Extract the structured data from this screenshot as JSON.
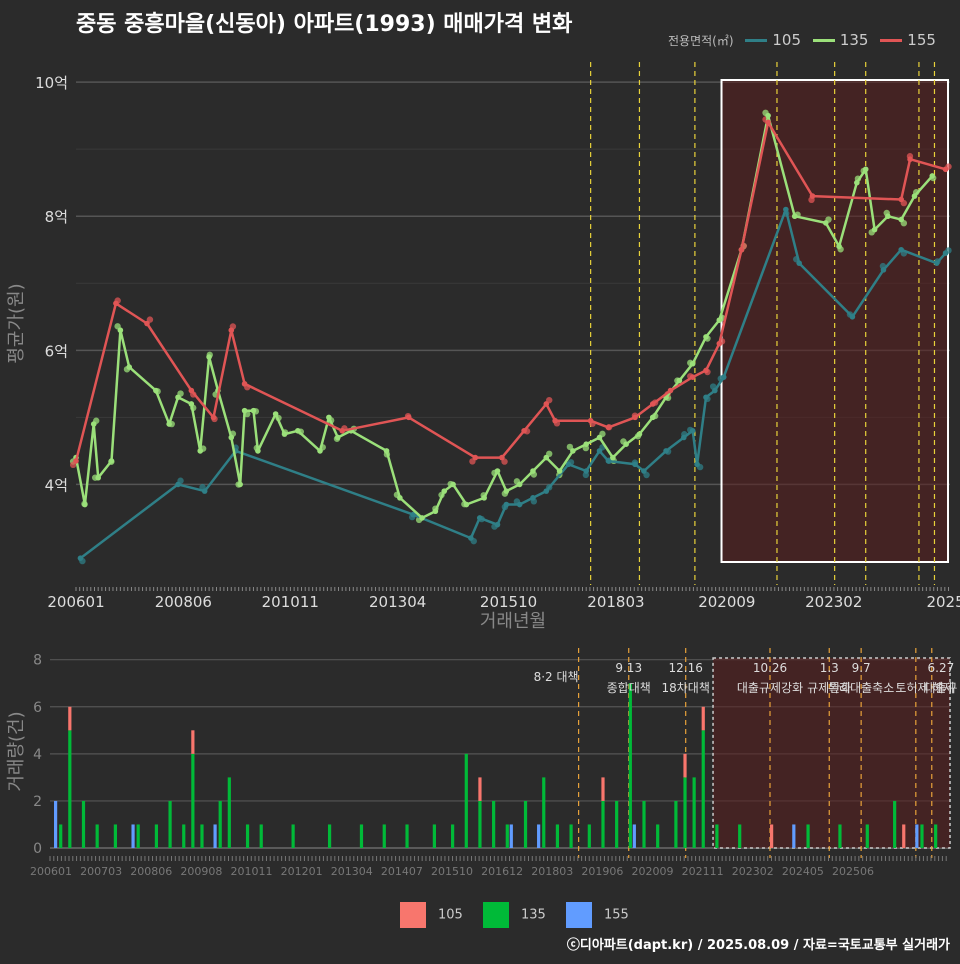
{
  "title": "중동 중흥마을(신동아) 아파트(1993) 매매가격 변화",
  "legend_title": "전용면적(㎡)",
  "colors": {
    "105": "#2f7f87",
    "135": "#9be07a",
    "155": "#e05555",
    "vol105": "#f8766d",
    "vol135": "#00ba38",
    "vol155": "#619cff",
    "event": "#e8d23a"
  },
  "caption": "ⓒ디아파트(dapt.kr) / 2025.08.09 / 자료=국토교통부 실거래가",
  "chart_data": [
    {
      "type": "line",
      "title": "중동 중흥마을(신동아) 아파트(1993) 매매가격 변화",
      "xlabel": "거래년월",
      "ylabel": "평균가(원)",
      "x_ticks": [
        "200601",
        "200806",
        "201011",
        "201304",
        "201510",
        "201803",
        "202009",
        "202302",
        "2025"
      ],
      "y_ticks": [
        "4억",
        "6억",
        "8억",
        "10억"
      ],
      "ylim": [
        2.5,
        10.3
      ],
      "xlim": [
        2006.0,
        2025.7
      ],
      "series": [
        {
          "name": "105",
          "points": [
            [
              2006.1,
              2.9
            ],
            [
              2008.3,
              4.0
            ],
            [
              2008.9,
              3.9
            ],
            [
              2009.6,
              4.5
            ],
            [
              2013.6,
              3.55
            ],
            [
              2014.9,
              3.2
            ],
            [
              2015.1,
              3.5
            ],
            [
              2015.5,
              3.4
            ],
            [
              2015.7,
              3.7
            ],
            [
              2016.0,
              3.7
            ],
            [
              2016.3,
              3.8
            ],
            [
              2016.6,
              3.9
            ],
            [
              2017.1,
              4.3
            ],
            [
              2017.5,
              4.2
            ],
            [
              2017.8,
              4.5
            ],
            [
              2018.0,
              4.35
            ],
            [
              2018.6,
              4.3
            ],
            [
              2018.8,
              4.2
            ],
            [
              2019.3,
              4.5
            ],
            [
              2019.7,
              4.7
            ],
            [
              2019.9,
              4.8
            ],
            [
              2020.0,
              4.3
            ],
            [
              2020.2,
              5.3
            ],
            [
              2020.4,
              5.4
            ],
            [
              2020.6,
              5.6
            ],
            [
              2022.0,
              8.1
            ],
            [
              2022.3,
              7.3
            ],
            [
              2023.5,
              6.5
            ],
            [
              2024.2,
              7.2
            ],
            [
              2024.6,
              7.5
            ],
            [
              2025.4,
              7.3
            ],
            [
              2025.6,
              7.45
            ]
          ]
        },
        {
          "name": "135",
          "points": [
            [
              2006.0,
              4.4
            ],
            [
              2006.2,
              3.7
            ],
            [
              2006.4,
              4.9
            ],
            [
              2006.5,
              4.1
            ],
            [
              2006.8,
              4.35
            ],
            [
              2007.0,
              6.3
            ],
            [
              2007.2,
              5.75
            ],
            [
              2007.8,
              5.4
            ],
            [
              2008.1,
              4.9
            ],
            [
              2008.3,
              5.3
            ],
            [
              2008.6,
              5.2
            ],
            [
              2008.8,
              4.5
            ],
            [
              2009.0,
              5.9
            ],
            [
              2009.2,
              5.4
            ],
            [
              2009.5,
              4.7
            ],
            [
              2009.7,
              4.0
            ],
            [
              2009.8,
              5.1
            ],
            [
              2010.0,
              5.1
            ],
            [
              2010.1,
              4.5
            ],
            [
              2010.5,
              5.05
            ],
            [
              2010.7,
              4.75
            ],
            [
              2011.0,
              4.8
            ],
            [
              2011.5,
              4.5
            ],
            [
              2011.7,
              5.0
            ],
            [
              2011.9,
              4.7
            ],
            [
              2012.2,
              4.8
            ],
            [
              2013.0,
              4.5
            ],
            [
              2013.3,
              3.8
            ],
            [
              2013.8,
              3.5
            ],
            [
              2014.1,
              3.6
            ],
            [
              2014.3,
              3.9
            ],
            [
              2014.5,
              4.0
            ],
            [
              2014.8,
              3.7
            ],
            [
              2015.2,
              3.8
            ],
            [
              2015.5,
              4.2
            ],
            [
              2015.7,
              3.9
            ],
            [
              2016.0,
              4.0
            ],
            [
              2016.3,
              4.2
            ],
            [
              2016.6,
              4.4
            ],
            [
              2016.9,
              4.2
            ],
            [
              2017.2,
              4.5
            ],
            [
              2017.5,
              4.6
            ],
            [
              2017.8,
              4.7
            ],
            [
              2018.1,
              4.4
            ],
            [
              2018.4,
              4.6
            ],
            [
              2018.7,
              4.75
            ],
            [
              2019.0,
              5.0
            ],
            [
              2019.3,
              5.3
            ],
            [
              2019.6,
              5.55
            ],
            [
              2019.9,
              5.8
            ],
            [
              2020.2,
              6.2
            ],
            [
              2020.5,
              6.45
            ],
            [
              2021.0,
              7.5
            ],
            [
              2021.6,
              9.5
            ],
            [
              2022.2,
              8.0
            ],
            [
              2022.9,
              7.9
            ],
            [
              2023.2,
              7.55
            ],
            [
              2023.6,
              8.5
            ],
            [
              2023.8,
              8.7
            ],
            [
              2024.0,
              7.8
            ],
            [
              2024.3,
              8.0
            ],
            [
              2024.6,
              7.95
            ],
            [
              2024.9,
              8.3
            ],
            [
              2025.3,
              8.6
            ]
          ]
        },
        {
          "name": "155",
          "points": [
            [
              2006.0,
              4.35
            ],
            [
              2006.9,
              6.7
            ],
            [
              2007.6,
              6.4
            ],
            [
              2008.6,
              5.4
            ],
            [
              2009.1,
              5.0
            ],
            [
              2009.5,
              6.3
            ],
            [
              2009.8,
              5.5
            ],
            [
              2012.0,
              4.8
            ],
            [
              2013.5,
              5.0
            ],
            [
              2015.0,
              4.4
            ],
            [
              2015.6,
              4.4
            ],
            [
              2016.1,
              4.8
            ],
            [
              2016.6,
              5.2
            ],
            [
              2016.8,
              4.95
            ],
            [
              2017.6,
              4.95
            ],
            [
              2018.0,
              4.85
            ],
            [
              2018.6,
              5.0
            ],
            [
              2019.0,
              5.2
            ],
            [
              2019.4,
              5.4
            ],
            [
              2019.9,
              5.6
            ],
            [
              2020.2,
              5.7
            ],
            [
              2020.5,
              6.1
            ],
            [
              2021.0,
              7.5
            ],
            [
              2021.6,
              9.4
            ],
            [
              2022.6,
              8.3
            ],
            [
              2024.6,
              8.25
            ],
            [
              2024.8,
              8.85
            ],
            [
              2025.6,
              8.7
            ]
          ]
        }
      ],
      "highlight_range": [
        2020.55,
        2025.7
      ],
      "event_lines": [
        2017.6,
        2018.7,
        2019.95,
        2021.8,
        2023.1,
        2023.8,
        2025.0,
        2025.35
      ]
    },
    {
      "type": "bar",
      "xlabel": "",
      "ylabel": "거래량(건)",
      "x_ticks": [
        "200601",
        "200703",
        "200806",
        "200908",
        "201011",
        "201201",
        "201304",
        "201407",
        "201510",
        "201612",
        "201803",
        "201906",
        "202009",
        "202111",
        "202302",
        "202405",
        "202506"
      ],
      "y_ticks": [
        "0",
        "2",
        "4",
        "6",
        "8"
      ],
      "ylim": [
        0,
        8.2
      ],
      "stacked": true,
      "series_names": [
        "105",
        "135",
        "155"
      ],
      "bars_135": [
        [
          2006.2,
          1
        ],
        [
          2006.4,
          5
        ],
        [
          2006.7,
          2
        ],
        [
          2007.0,
          1
        ],
        [
          2007.4,
          1
        ],
        [
          2007.9,
          1
        ],
        [
          2008.3,
          1
        ],
        [
          2008.6,
          2
        ],
        [
          2008.9,
          1
        ],
        [
          2009.1,
          4
        ],
        [
          2009.3,
          1
        ],
        [
          2009.7,
          2
        ],
        [
          2009.9,
          3
        ],
        [
          2010.3,
          1
        ],
        [
          2010.6,
          1
        ],
        [
          2011.3,
          1
        ],
        [
          2012.1,
          1
        ],
        [
          2012.8,
          1
        ],
        [
          2013.3,
          1
        ],
        [
          2013.8,
          1
        ],
        [
          2014.4,
          1
        ],
        [
          2014.8,
          1
        ],
        [
          2015.1,
          4
        ],
        [
          2015.4,
          2
        ],
        [
          2015.7,
          2
        ],
        [
          2016.0,
          1
        ],
        [
          2016.4,
          2
        ],
        [
          2016.8,
          3
        ],
        [
          2017.1,
          1
        ],
        [
          2017.4,
          1
        ],
        [
          2017.8,
          1
        ],
        [
          2018.1,
          2
        ],
        [
          2018.4,
          2
        ],
        [
          2018.7,
          7
        ],
        [
          2019.0,
          2
        ],
        [
          2019.3,
          1
        ],
        [
          2019.7,
          2
        ],
        [
          2019.9,
          3
        ],
        [
          2020.1,
          3
        ],
        [
          2020.3,
          5
        ],
        [
          2020.6,
          1
        ],
        [
          2021.1,
          1
        ],
        [
          2022.6,
          1
        ],
        [
          2023.3,
          1
        ],
        [
          2023.9,
          1
        ],
        [
          2024.5,
          2
        ],
        [
          2025.1,
          1
        ],
        [
          2025.4,
          1
        ]
      ],
      "bars_105": [
        [
          2006.4,
          1
        ],
        [
          2009.1,
          1
        ],
        [
          2015.4,
          1
        ],
        [
          2018.1,
          1
        ],
        [
          2019.9,
          1
        ],
        [
          2020.3,
          1
        ],
        [
          2021.8,
          1
        ],
        [
          2024.7,
          1
        ]
      ],
      "bars_155": [
        [
          2006.0,
          2
        ],
        [
          2007.7,
          1
        ],
        [
          2009.5,
          1
        ],
        [
          2016.0,
          1
        ],
        [
          2016.6,
          1
        ],
        [
          2018.7,
          1
        ],
        [
          2022.2,
          1
        ],
        [
          2024.9,
          1
        ]
      ],
      "highlight_range": [
        2020.55,
        2025.7
      ],
      "event_lines": [
        2017.6,
        2018.7,
        2019.95,
        2021.8,
        2023.1,
        2023.8,
        2025.0,
        2025.35
      ],
      "annotations": [
        {
          "date": "8·2 대책",
          "label": ""
        },
        {
          "date": "9.13",
          "label": "종합대책"
        },
        {
          "date": "12.16",
          "label": "18차대책"
        },
        {
          "date": "10.26",
          "label": "대출규제강화"
        },
        {
          "date": "1.3",
          "label": "규제완화"
        },
        {
          "date": "9.7",
          "label": "특례대출축소"
        },
        {
          "date": "",
          "label": "토허제 해제"
        },
        {
          "date": "6.27",
          "label": "대출규"
        }
      ]
    }
  ]
}
